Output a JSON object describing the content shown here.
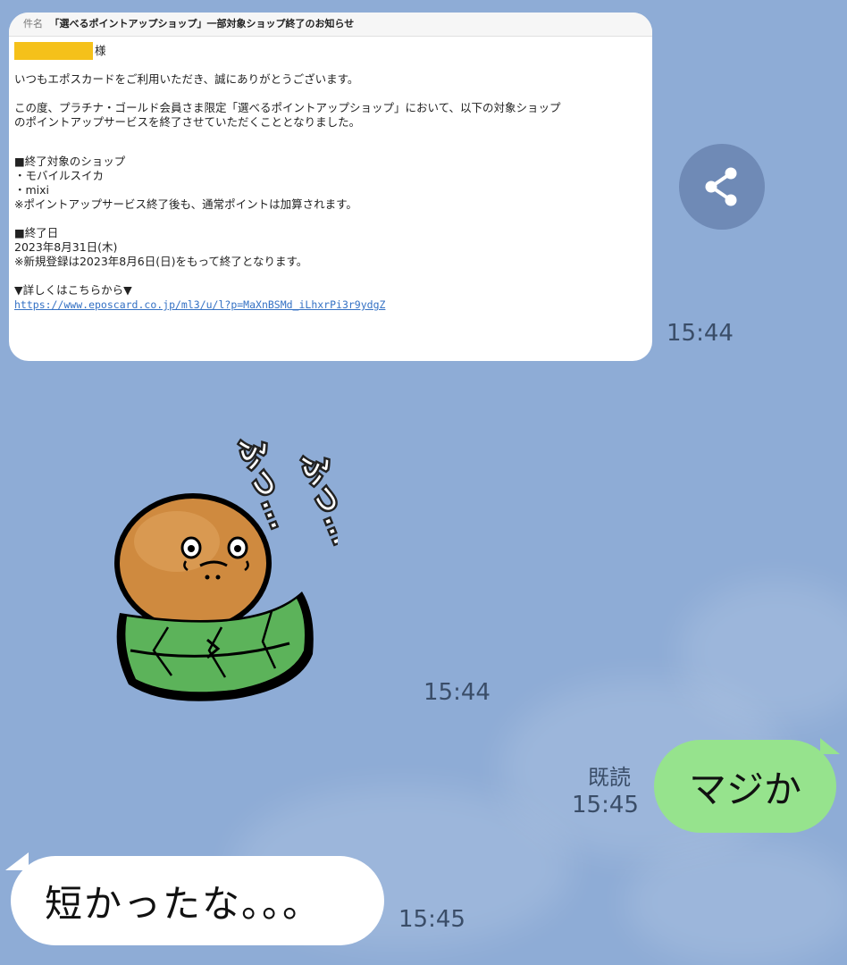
{
  "image_message": {
    "subject_label": "件名",
    "subject": "「選べるポイントアップショップ」一部対象ショップ終了のお知らせ",
    "honorific": "様",
    "greeting": "いつもエポスカードをご利用いただき、誠にありがとうございます。",
    "body_line1": "この度、プラチナ・ゴールド会員さま限定「選べるポイントアップショップ」において、以下の対象ショップ",
    "body_line2": "のポイントアップサービスを終了させていただくこととなりました。",
    "section1_title": "■終了対象のショップ",
    "shop1": "・モバイルスイカ",
    "shop2": "・mixi",
    "note1": "※ポイントアップサービス終了後も、通常ポイントは加算されます。",
    "section2_title": "■終了日",
    "end_date": "2023年8月31日(木)",
    "note2": "※新規登録は2023年8月6日(日)をもって終了となります。",
    "details_label": "▼詳しくはこちらから▼",
    "link": "https://www.eposcard.co.jp/ml3/u/l?p=MaXnBSMd_iLhxrPi3r9ydgZ",
    "time": "15:44"
  },
  "sticker_message": {
    "text1": "ふっ…",
    "text2": "ふっ…",
    "time": "15:44"
  },
  "outgoing_message": {
    "text": "マジか",
    "read_status": "既読",
    "time": "15:45"
  },
  "incoming_message": {
    "text": "短かったな。。。",
    "time": "15:45"
  },
  "colors": {
    "background": "#8eacd6",
    "outgoing_bubble": "#96e38d",
    "incoming_bubble": "#ffffff",
    "redaction": "#f5c11a",
    "link": "#3471c4"
  }
}
